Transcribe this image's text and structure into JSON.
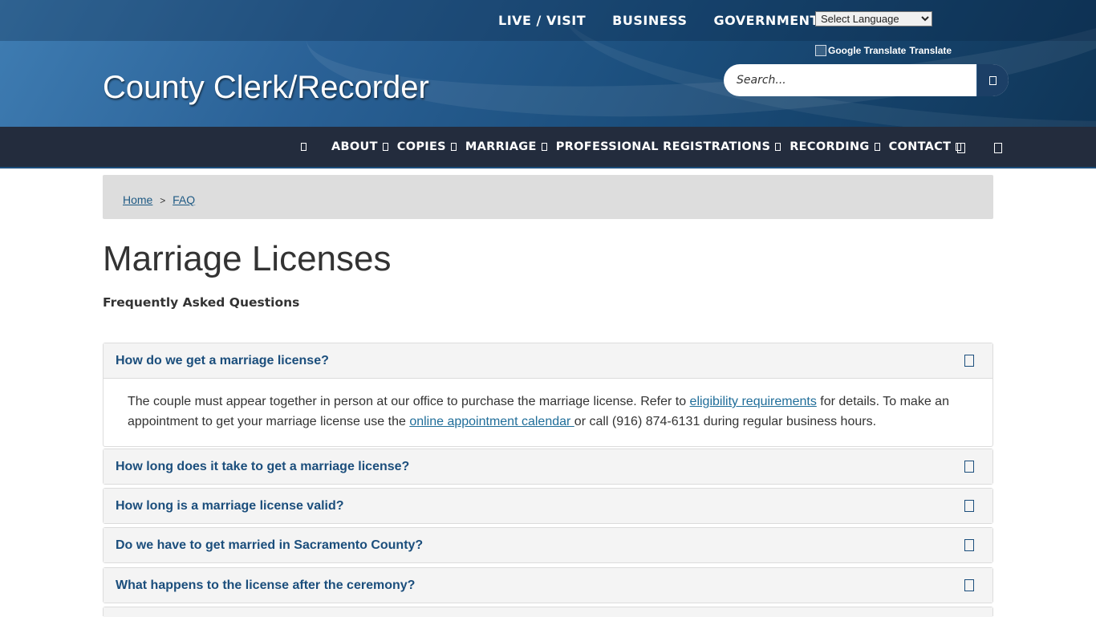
{
  "topnav": {
    "links": [
      "LIVE / VISIT",
      "BUSINESS",
      "GOVERNMENT"
    ],
    "language_select": "Select Language",
    "google_translate_alt": "Google Translate",
    "translate_label": "Translate"
  },
  "site": {
    "title": "County Clerk/Recorder"
  },
  "search": {
    "placeholder": "Search..."
  },
  "mainnav": {
    "items": [
      {
        "label": "ABOUT"
      },
      {
        "label": "COPIES"
      },
      {
        "label": "MARRIAGE"
      },
      {
        "label": "PROFESSIONAL REGISTRATIONS"
      },
      {
        "label": "RECORDING"
      },
      {
        "label": "CONTACT"
      }
    ]
  },
  "breadcrumb": {
    "home": "Home",
    "separator": ">",
    "current": "FAQ"
  },
  "page": {
    "title": "Marriage Licenses",
    "subtitle": "Frequently Asked Questions"
  },
  "faq": {
    "items": [
      {
        "question": "How do we get a marriage license?",
        "answer": {
          "part1": "The couple must appear together in person at our office to purchase the marriage license. Refer to ",
          "link1": "eligibility requirements",
          "part2": " for details. To make an appointment to get your marriage license use the ",
          "link2": "online appointment calendar ",
          "part3": "or call (916) 874-6131 during regular business hours."
        }
      },
      {
        "question": "How long does it take to get a marriage license?"
      },
      {
        "question": "How long is a marriage license valid?"
      },
      {
        "question": "Do we have to get married in Sacramento County?"
      },
      {
        "question": "What happens to the license after the ceremony?"
      }
    ]
  }
}
